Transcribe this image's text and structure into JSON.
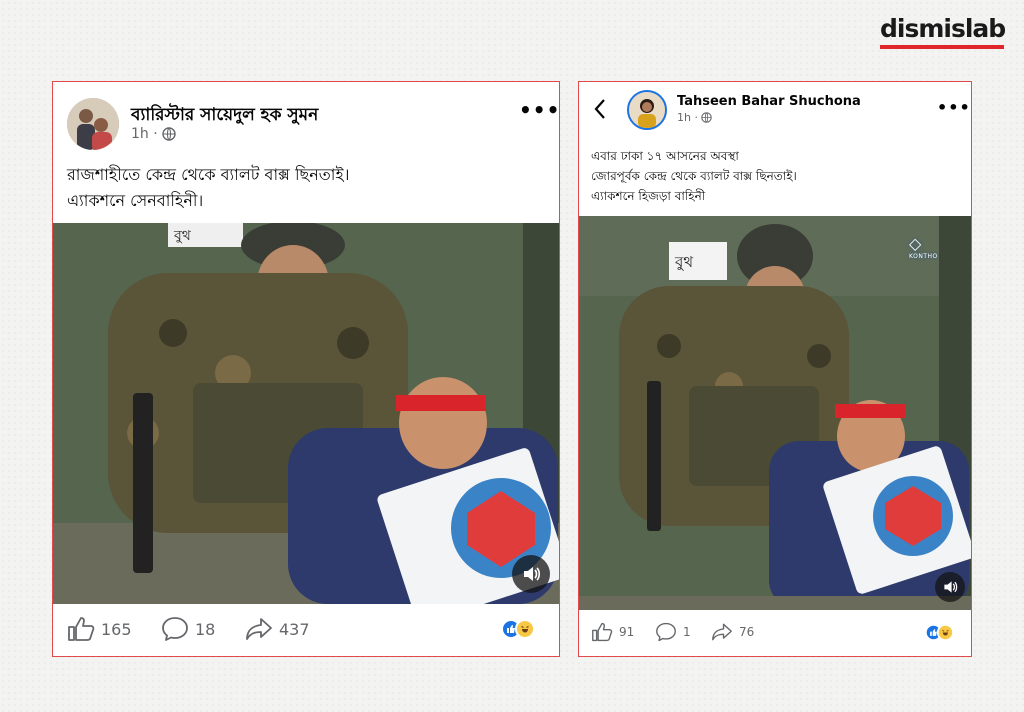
{
  "brand": {
    "name": "dismislab"
  },
  "left_post": {
    "author": "ব্যারিস্টার সায়েদুল হক সুমন",
    "time": "1h ·",
    "text_lines": [
      "রাজশাহীতে কেন্দ্র থেকে ব্যালট বাক্স ছিনতাই।",
      "এ্যাকশনে সেনবাহিনী।"
    ],
    "image_sign": "বুথ",
    "likes": "165",
    "comments": "18",
    "shares": "437"
  },
  "right_post": {
    "author": "Tahseen Bahar Shuchona",
    "time": "1h ·",
    "text_lines": [
      "এবার ঢাকা ১৭ আসনের অবস্থা",
      "জোরপূর্বক কেন্দ্র থেকে ব্যালট বাক্স ছিনতাই।",
      "এ্যাকশনে হিজড়া বাহিনী"
    ],
    "image_sign": "বুথ",
    "watermark": "KONTHO",
    "likes": "91",
    "comments": "1",
    "shares": "76"
  },
  "icons": [
    "more-icon",
    "globe-icon",
    "back-icon",
    "like-icon",
    "comment-icon",
    "share-icon",
    "sound-icon",
    "like-reaction-icon",
    "haha-reaction-icon"
  ]
}
